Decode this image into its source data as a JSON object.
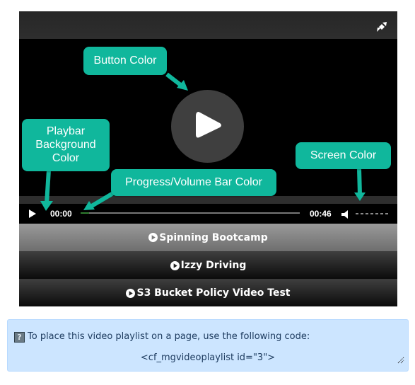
{
  "player": {
    "current_time": "00:00",
    "duration": "00:46",
    "progress_fraction": 0.04,
    "icons": {
      "fullscreen": "fullscreen-toggle-icon",
      "big_play": "play-icon",
      "controls_play": "play-icon",
      "volume": "volume-icon"
    }
  },
  "callouts": {
    "button_color": "Button Color",
    "playbar_background_line1": "Playbar",
    "playbar_background_line2": "Background",
    "playbar_background_line3": "Color",
    "progress_volume": "Progress/Volume Bar Color",
    "screen_color": "Screen Color"
  },
  "playlist": {
    "items": [
      {
        "title": "Spinning Bootcamp",
        "active": true
      },
      {
        "title": "Izzy Driving",
        "active": false
      },
      {
        "title": "S3 Bucket Policy Video Test",
        "active": false
      }
    ]
  },
  "info": {
    "help_icon": "?",
    "message": "To place this video playlist on a page, use the following code:",
    "code": "<cf_mgvideoplaylist id=\"3\">"
  },
  "colors": {
    "callout": "#10b79c",
    "info_background": "#cce5ff",
    "progress_fill": "#2f7d2f"
  }
}
